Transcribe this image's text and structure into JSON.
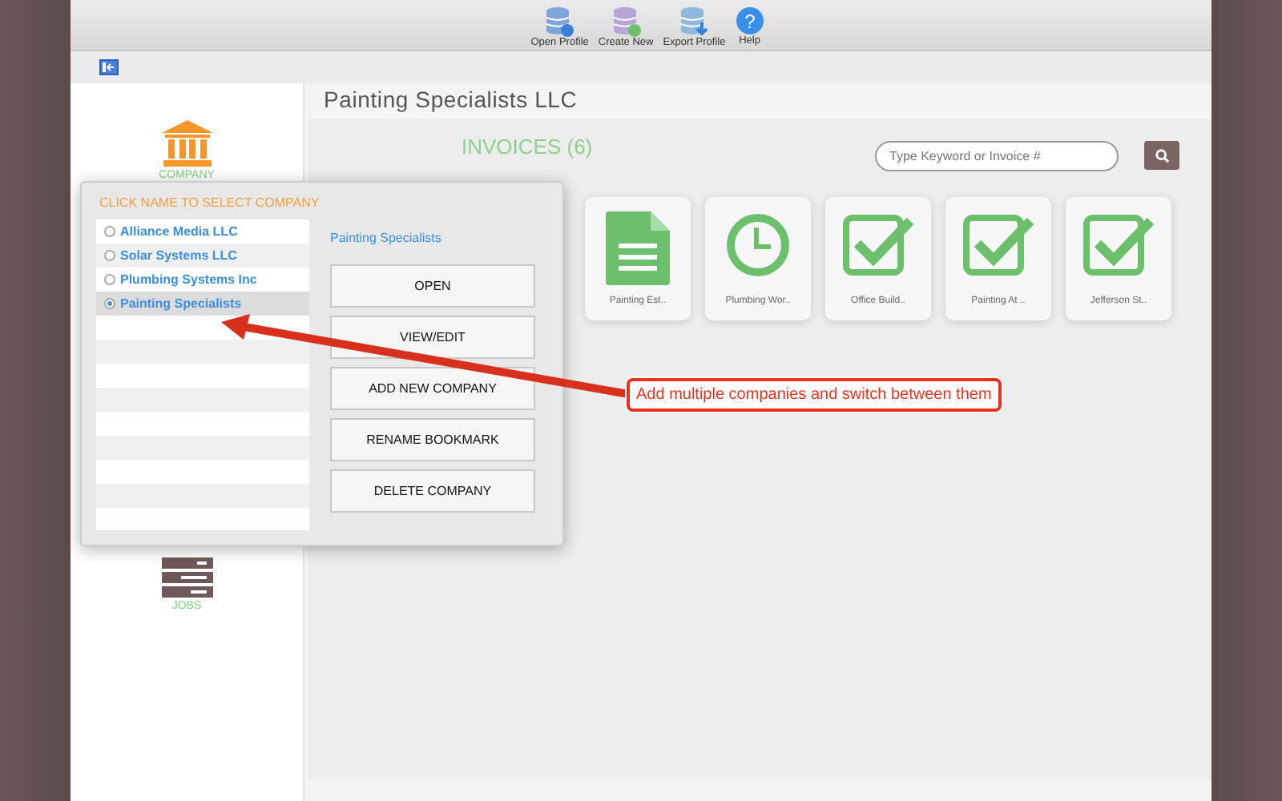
{
  "toolbar": [
    {
      "label": "Open Profile",
      "kind": "open"
    },
    {
      "label": "Create New",
      "kind": "create"
    },
    {
      "label": "Export Profile",
      "kind": "export"
    },
    {
      "label": "Help",
      "kind": "help",
      "glyph": "?"
    }
  ],
  "company_title": "Painting Specialists LLC",
  "sidebar": {
    "items": [
      {
        "label": "COMPANY",
        "kind": "company"
      },
      {
        "label": "JOBS",
        "kind": "jobs"
      }
    ]
  },
  "invoices": {
    "title": "INVOICES (6)",
    "search": {
      "placeholder": "Type Keyword or Invoice #"
    },
    "cards": [
      {
        "label": "Painting Est..",
        "kind": "document"
      },
      {
        "label": "Plumbing Wor..",
        "kind": "clock"
      },
      {
        "label": "Office Build..",
        "kind": "check"
      },
      {
        "label": "Painting At ..",
        "kind": "check"
      },
      {
        "label": "Jefferson St..",
        "kind": "check"
      }
    ]
  },
  "popup": {
    "heading": "CLICK NAME TO SELECT COMPANY",
    "companies": [
      {
        "name": "Alliance Media LLC",
        "selected": false
      },
      {
        "name": "Solar Systems LLC",
        "selected": false
      },
      {
        "name": "Plumbing Systems Inc",
        "selected": false
      },
      {
        "name": "Painting Specialists",
        "selected": true
      }
    ],
    "current": "Painting Specialists",
    "buttons": [
      "OPEN",
      "VIEW/EDIT",
      "ADD NEW COMPANY",
      "RENAME BOOKMARK",
      "DELETE COMPANY"
    ]
  },
  "annotation": {
    "text": "Add multiple companies and switch between them"
  }
}
